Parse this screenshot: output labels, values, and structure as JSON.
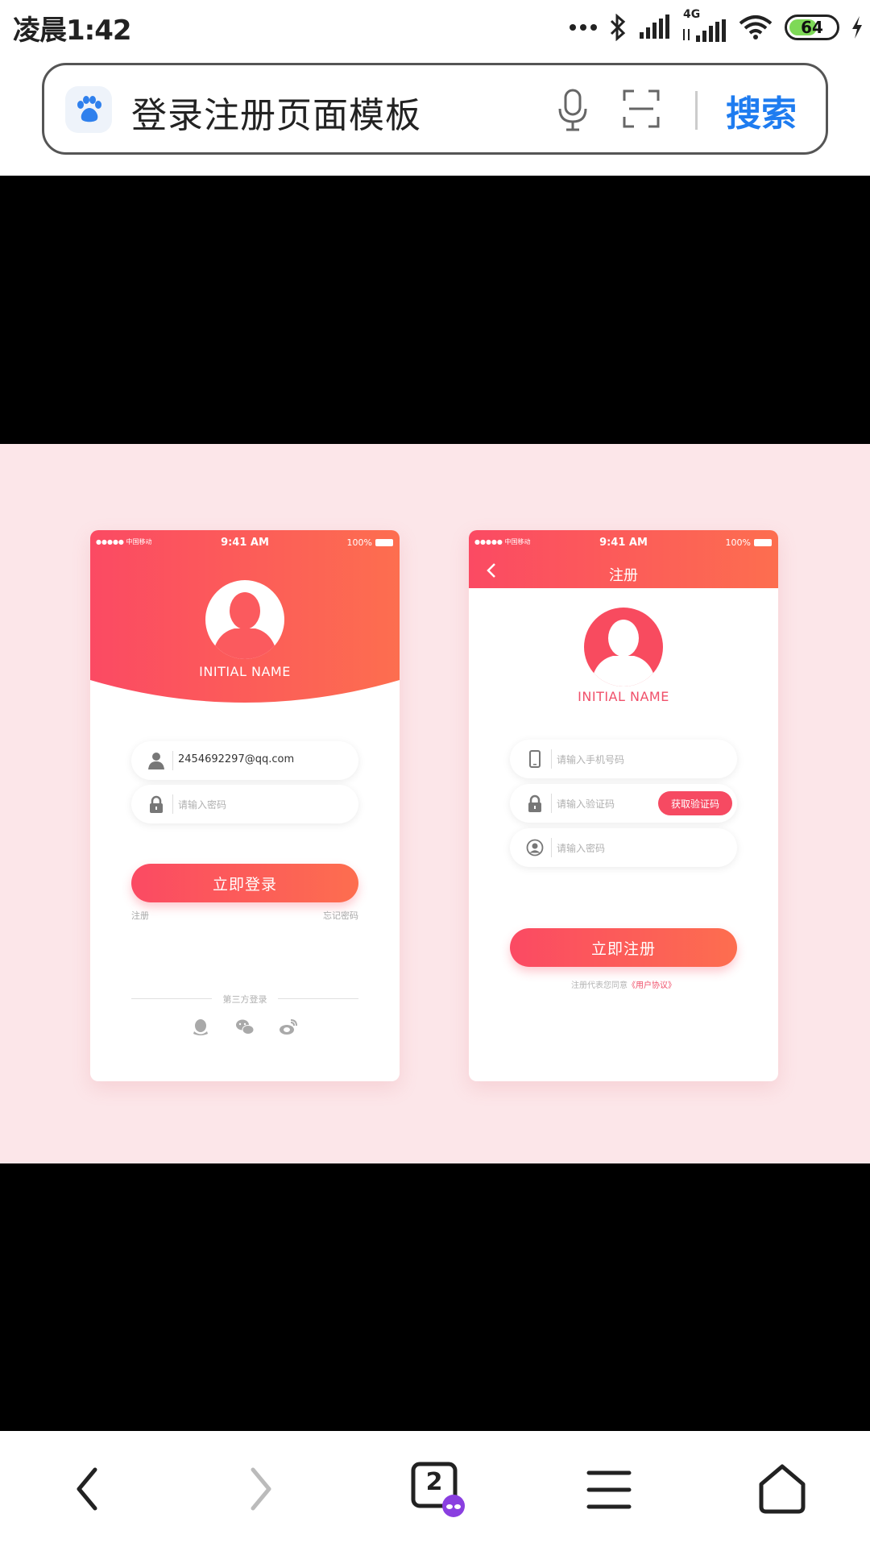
{
  "status_bar": {
    "time": "凌晨1:42",
    "network": "4G",
    "battery": "64",
    "battery_level": 0.64
  },
  "search": {
    "query": "登录注册页面模板",
    "button_label": "搜索"
  },
  "colors": {
    "accent": "#f64a62",
    "gradient_end": "#fd6e4f",
    "link_blue": "#1e7cf0",
    "bg_pink": "#fce6e9"
  },
  "login_mock": {
    "status": {
      "signal": "●●●●● 中国移动",
      "time": "9:41 AM",
      "battery": "100%"
    },
    "name": "INITIAL NAME",
    "account_value": "2454692297@qq.com",
    "password_placeholder": "请输入密码",
    "login_button": "立即登录",
    "register_link": "注册",
    "forgot_link": "忘记密码",
    "third_party_label": "第三方登录",
    "social_icons": [
      "qq-icon",
      "wechat-icon",
      "weibo-icon"
    ]
  },
  "register_mock": {
    "status": {
      "signal": "●●●●● 中国移动",
      "time": "9:41 AM",
      "battery": "100%"
    },
    "title": "注册",
    "name": "INITIAL NAME",
    "phone_placeholder": "请输入手机号码",
    "code_placeholder": "请输入验证码",
    "code_button": "获取验证码",
    "password_placeholder": "请输入密码",
    "register_button": "立即注册",
    "agreement_prefix": "注册代表您同意",
    "agreement_link": "《用户协议》"
  },
  "nav": {
    "tabs_count": "2"
  }
}
